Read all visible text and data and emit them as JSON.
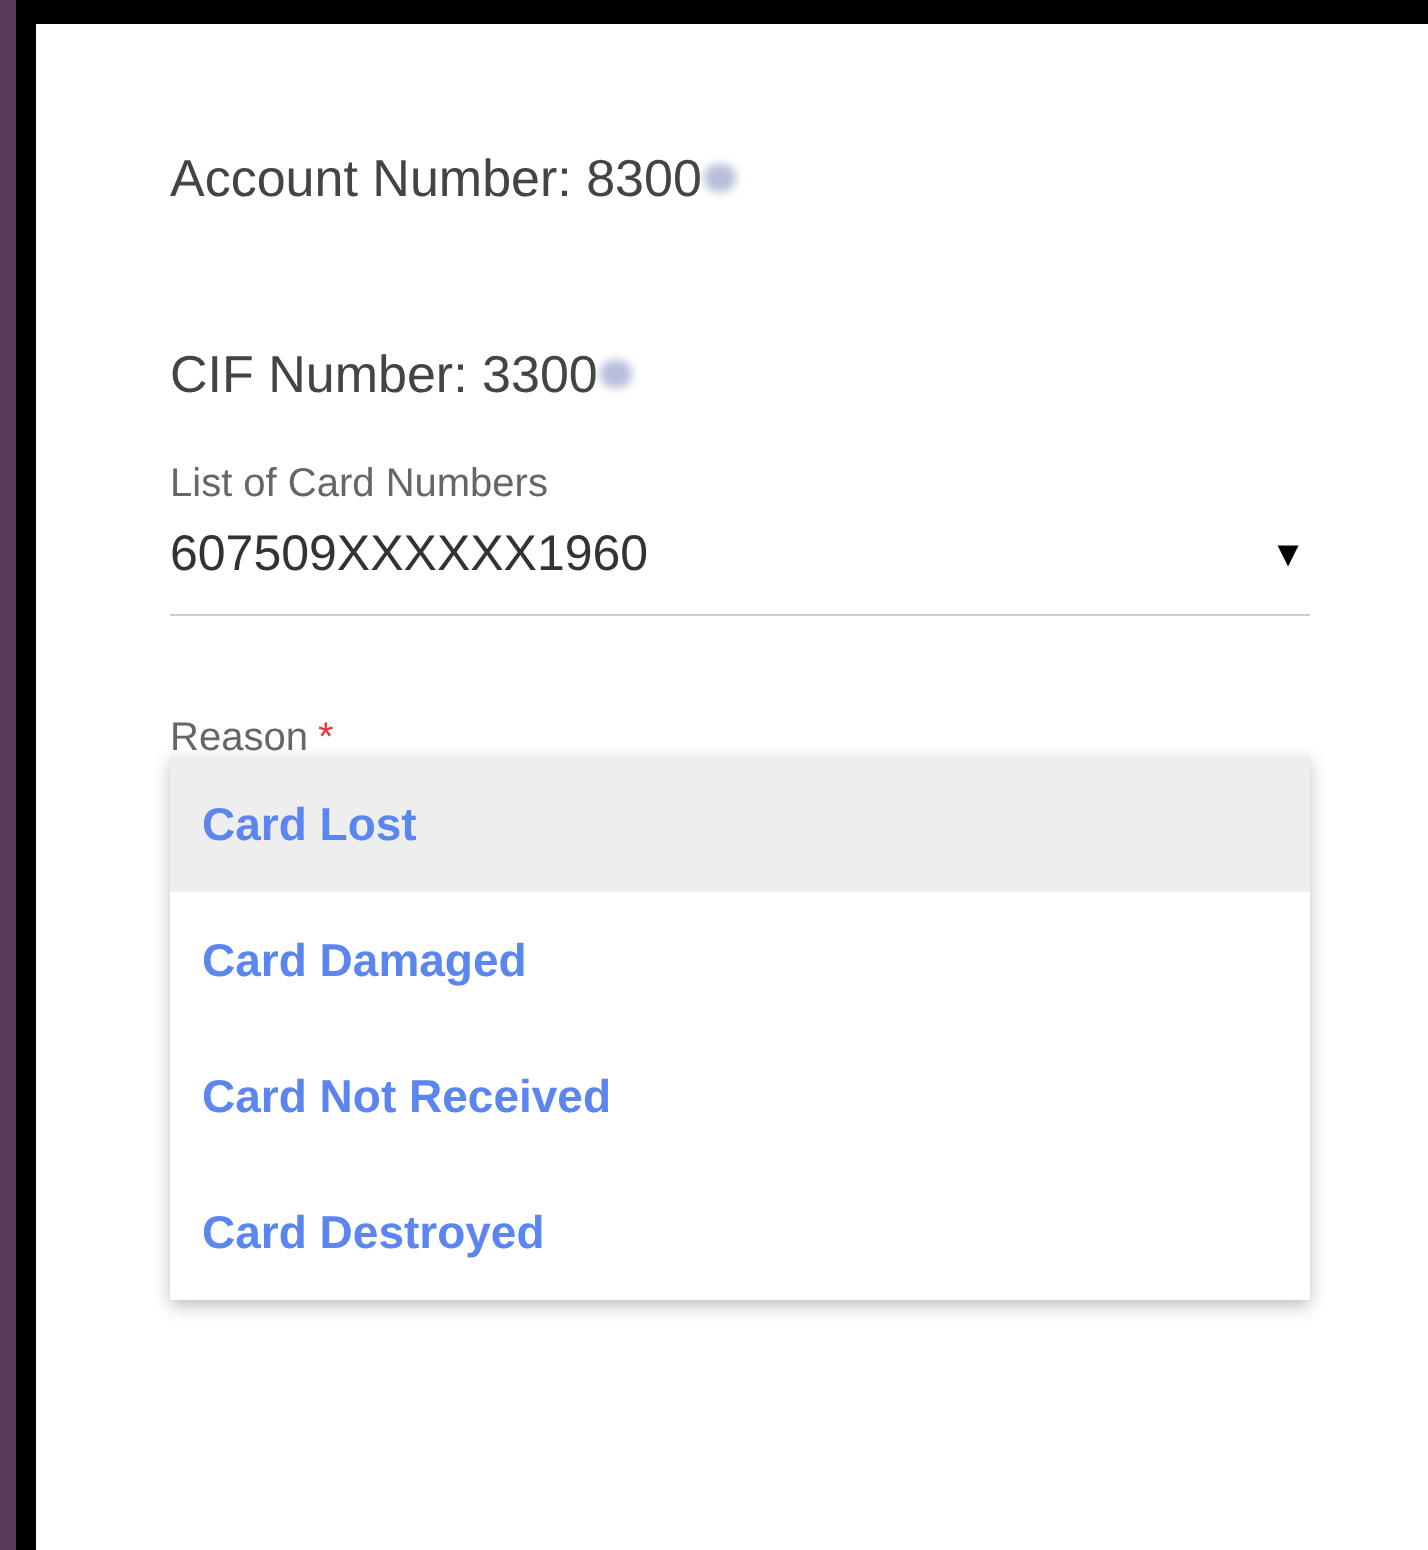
{
  "account_number": {
    "label": "Account Number: 8300",
    "redacted": true
  },
  "cif_number": {
    "label": "CIF Number: 3300",
    "redacted": true
  },
  "card_select": {
    "label": "List of Card Numbers",
    "value": "607509XXXXXX1960",
    "icon": "▼"
  },
  "reason": {
    "label": "Reason",
    "required_mark": "*"
  },
  "reason_options": [
    {
      "label": "Card Lost",
      "selected": true
    },
    {
      "label": "Card Damaged",
      "selected": false
    },
    {
      "label": "Card Not Received",
      "selected": false
    },
    {
      "label": "Card Destroyed",
      "selected": false
    }
  ]
}
